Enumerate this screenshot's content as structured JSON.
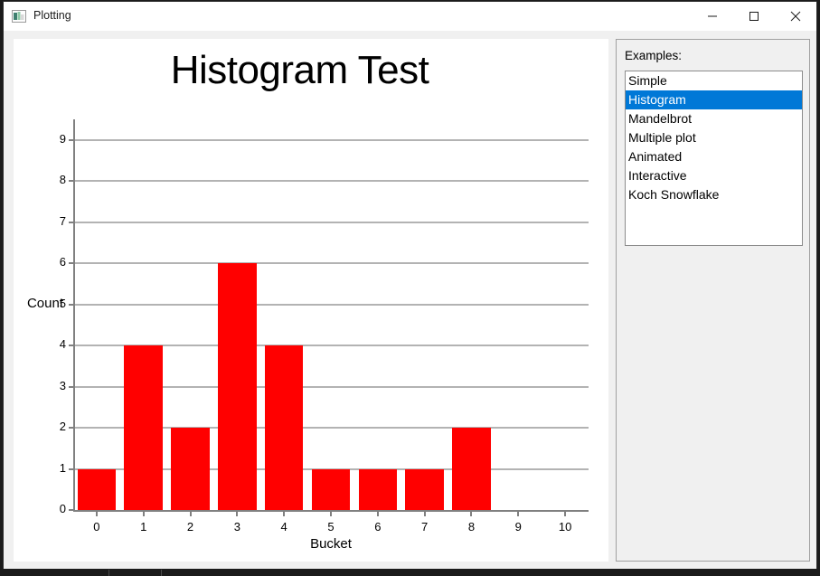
{
  "window": {
    "title": "Plotting",
    "icon": "plot-app-icon",
    "controls": {
      "minimize": "minimize-icon",
      "maximize": "maximize-icon",
      "close": "close-icon"
    }
  },
  "side_panel": {
    "label": "Examples:",
    "items": [
      {
        "label": "Simple",
        "selected": false
      },
      {
        "label": "Histogram",
        "selected": true
      },
      {
        "label": "Mandelbrot",
        "selected": false
      },
      {
        "label": "Multiple plot",
        "selected": false
      },
      {
        "label": "Animated",
        "selected": false
      },
      {
        "label": "Interactive",
        "selected": false
      },
      {
        "label": "Koch Snowflake",
        "selected": false
      }
    ],
    "selected_value": "Histogram",
    "accent_color": "#0078d7"
  },
  "chart_data": {
    "type": "bar",
    "title": "Histogram Test",
    "xlabel": "Bucket",
    "ylabel": "Count",
    "categories": [
      "0",
      "1",
      "2",
      "3",
      "4",
      "5",
      "6",
      "7",
      "8",
      "9",
      "10"
    ],
    "values": [
      1,
      4,
      2,
      6,
      4,
      1,
      1,
      1,
      2,
      0,
      0
    ],
    "xlim": [
      -0.5,
      10.5
    ],
    "ylim": [
      0,
      9.5
    ],
    "yticks": [
      0,
      1,
      2,
      3,
      4,
      5,
      6,
      7,
      8,
      9
    ],
    "xticks": [
      0,
      1,
      2,
      3,
      4,
      5,
      6,
      7,
      8,
      9,
      10
    ],
    "grid": true,
    "legend": false,
    "bar_color": "#ff0000",
    "grid_color": "#b3b3b3",
    "axis_color": "#808080"
  }
}
